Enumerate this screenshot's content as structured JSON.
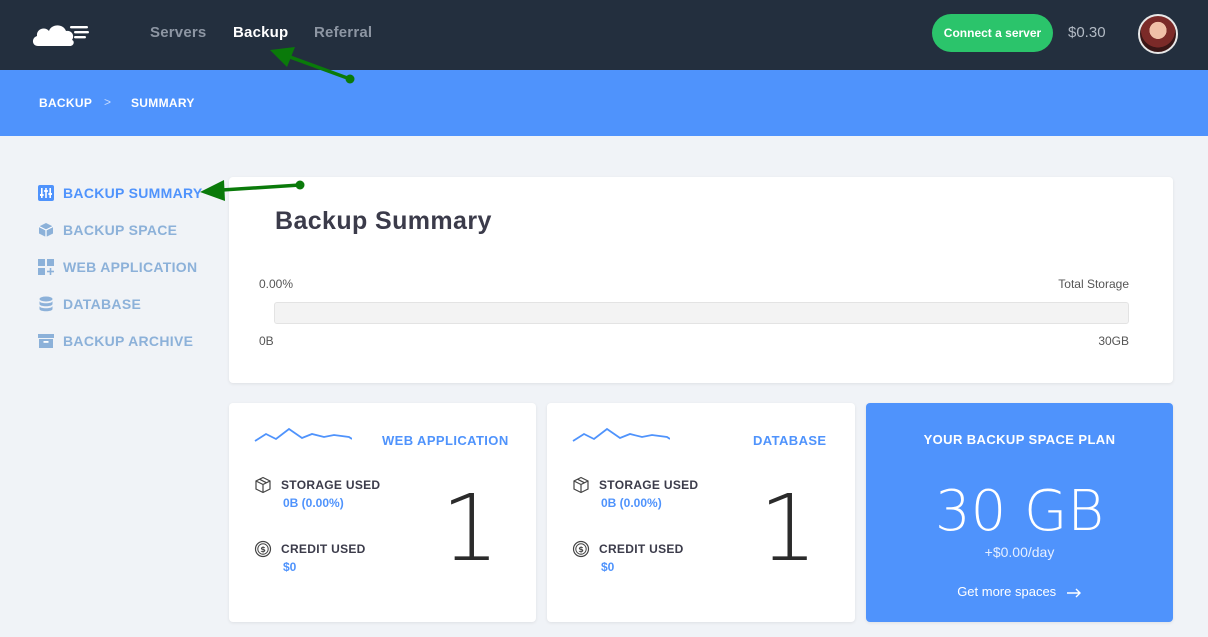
{
  "topnav": {
    "items": [
      {
        "label": "Servers"
      },
      {
        "label": "Backup"
      },
      {
        "label": "Referral"
      }
    ],
    "connect_button": "Connect a server",
    "balance": "$0.30"
  },
  "breadcrumb": {
    "items": [
      "BACKUP",
      "SUMMARY"
    ],
    "separator": ">"
  },
  "sidebar": {
    "items": [
      {
        "label": "BACKUP SUMMARY",
        "icon": "sliders-icon",
        "active": true
      },
      {
        "label": "BACKUP SPACE",
        "icon": "cube-icon",
        "active": false
      },
      {
        "label": "WEB APPLICATION",
        "icon": "apps-plus-icon",
        "active": false
      },
      {
        "label": "DATABASE",
        "icon": "database-icon",
        "active": false
      },
      {
        "label": "BACKUP ARCHIVE",
        "icon": "archive-box-icon",
        "active": false
      }
    ]
  },
  "summary": {
    "title": "Backup Summary",
    "percent_label": "0.00%",
    "total_label": "Total Storage",
    "min_label": "0B",
    "max_label": "30GB",
    "usage_fraction": 0
  },
  "web_application": {
    "title": "WEB APPLICATION",
    "storage_label": "STORAGE USED",
    "storage_value": "0B (0.00%)",
    "credit_label": "CREDIT USED",
    "credit_value": "$0",
    "count": "1"
  },
  "database": {
    "title": "DATABASE",
    "storage_label": "STORAGE USED",
    "storage_value": "0B (0.00%)",
    "credit_label": "CREDIT USED",
    "credit_value": "$0",
    "count": "1"
  },
  "plan": {
    "title": "YOUR BACKUP SPACE PLAN",
    "size": "30 GB",
    "rate": "+$0.00/day",
    "link": "Get more spaces"
  },
  "colors": {
    "nav_bg": "#232f3e",
    "accent": "#4f93fc",
    "success": "#2bc46b",
    "annotation_arrow": "#0a7a0a"
  }
}
